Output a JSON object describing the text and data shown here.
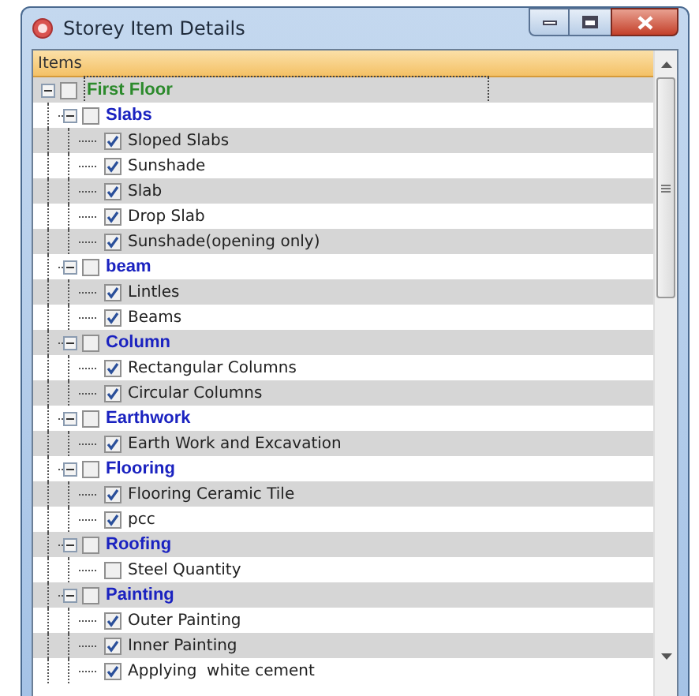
{
  "window": {
    "title": "Storey Item Details"
  },
  "tree_header": "Items",
  "tree": [
    {
      "label": "First Floor",
      "expanded": true,
      "checked": false,
      "focused": true,
      "children": [
        {
          "label": "Slabs",
          "expanded": true,
          "checked": false,
          "children": [
            {
              "label": "Sloped Slabs",
              "checked": true
            },
            {
              "label": "Sunshade",
              "checked": true
            },
            {
              "label": "Slab",
              "checked": true
            },
            {
              "label": "Drop Slab",
              "checked": true
            },
            {
              "label": "Sunshade(opening only)",
              "checked": true
            }
          ]
        },
        {
          "label": "beam",
          "expanded": true,
          "checked": false,
          "children": [
            {
              "label": "Lintles",
              "checked": true
            },
            {
              "label": "Beams",
              "checked": true
            }
          ]
        },
        {
          "label": "Column",
          "expanded": true,
          "checked": false,
          "children": [
            {
              "label": "Rectangular Columns",
              "checked": true
            },
            {
              "label": "Circular Columns",
              "checked": true
            }
          ]
        },
        {
          "label": "Earthwork",
          "expanded": true,
          "checked": false,
          "children": [
            {
              "label": "Earth Work and Excavation",
              "checked": true
            }
          ]
        },
        {
          "label": "Flooring",
          "expanded": true,
          "checked": false,
          "children": [
            {
              "label": "Flooring Ceramic Tile",
              "checked": true
            },
            {
              "label": "pcc",
              "checked": true
            }
          ]
        },
        {
          "label": "Roofing",
          "expanded": true,
          "checked": false,
          "children": [
            {
              "label": "Steel Quantity",
              "checked": false
            }
          ]
        },
        {
          "label": "Painting",
          "expanded": true,
          "checked": false,
          "children": [
            {
              "label": "Outer Painting",
              "checked": true
            },
            {
              "label": "Inner Painting",
              "checked": true
            },
            {
              "label": "Applying  white cement",
              "checked": true
            }
          ]
        }
      ]
    }
  ]
}
